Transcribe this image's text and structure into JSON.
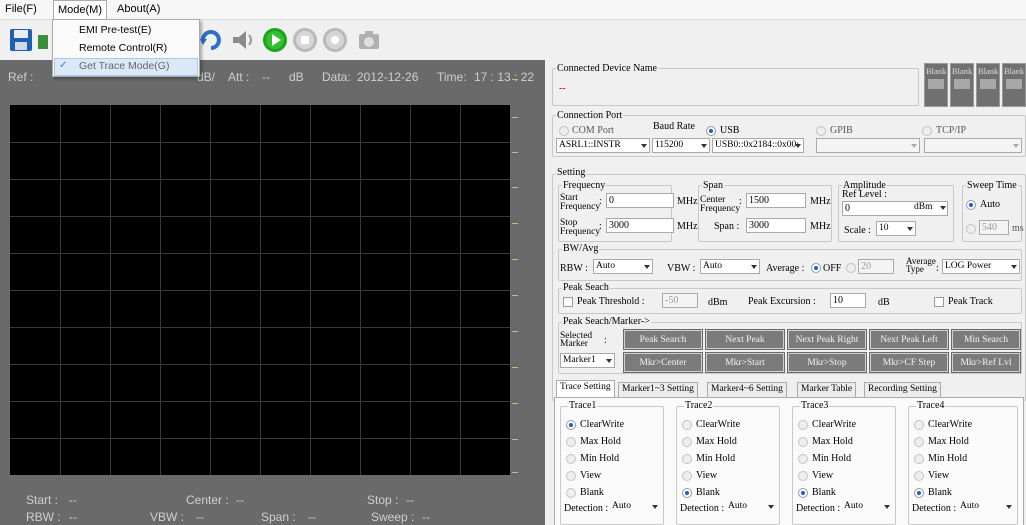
{
  "menubar": {
    "file": "File(F)",
    "mode": "Mode(M)",
    "about": "About(A)"
  },
  "mode_menu": {
    "items": [
      "EMI Pre-test(E)",
      "Remote Control(R)",
      "Get Trace Mode(G)"
    ]
  },
  "toolbar": {
    "icons": [
      "save-icon",
      "open-icon",
      "refresh-icon",
      "speaker-icon",
      "play-icon",
      "stop-icon",
      "record-icon",
      "camera-icon"
    ]
  },
  "top_info": {
    "ref_label": "Ref :",
    "db_div": "dB/",
    "att_label": "Att :",
    "att_value": "--",
    "att_unit": "dB",
    "data_label": "Data:",
    "data_value": "2012-12-26",
    "time_label": "Time:",
    "time_value": "17 : 13 : 22"
  },
  "bottom_info": {
    "start_label": "Start :",
    "start_value": "--",
    "center_label": "Center :",
    "center_value": "--",
    "stop_label": "Stop :",
    "stop_value": "--",
    "rbw_label": "RBW :",
    "rbw_value": "--",
    "vbw_label": "VBW :",
    "vbw_value": "--",
    "span_label": "Span :",
    "span_value": "--",
    "sweep_label": "Sweep :",
    "sweep_value": "--"
  },
  "connected": {
    "title": "Connected Device Name",
    "value": "--",
    "blanks": [
      "Blank",
      "Blank",
      "Blank",
      "Blank"
    ]
  },
  "connection_port": {
    "title": "Connection Port",
    "com_port": "COM Port",
    "baud_rate": "Baud Rate",
    "usb": "USB",
    "gpib": "GPIB",
    "tcpip": "TCP/IP",
    "com_value": "ASRL1::INSTR",
    "baud_value": "115200",
    "usb_value": "USB0::0x2184::0x00:"
  },
  "setting": {
    "title": "Setting",
    "frequency": {
      "title": "Frequecny",
      "start_label": "Start\nFrequency",
      "start_value": "0",
      "stop_label": "Stop\nFrequency",
      "stop_value": "3000",
      "unit": "MHz"
    },
    "span": {
      "title": "Span",
      "center_label": "Center\nFrequency",
      "center_value": "1500",
      "span_label": "Span :",
      "span_value": "3000",
      "unit": "MHz"
    },
    "amplitude": {
      "title": "Amplitude",
      "ref_label": "Ref Level :",
      "ref_value": "0",
      "ref_unit": "dBm",
      "scale_label": "Scale :",
      "scale_value": "10"
    },
    "sweep": {
      "title": "Sweep Time",
      "auto": "Auto",
      "ms_value": "540",
      "ms": "ms"
    },
    "bw": {
      "title": "BW/Avg",
      "rbw_label": "RBW :",
      "rbw_value": "Auto",
      "vbw_label": "VBW :",
      "vbw_value": "Auto",
      "avg_label": "Average :",
      "off": "OFF",
      "avg_num": "20",
      "avg_type_label": "Average\nType",
      "avg_type_value": "LOG Power"
    },
    "peak": {
      "title": "Peak Seach",
      "threshold_label": "Peak Threshold :",
      "threshold_value": "-50",
      "threshold_unit": "dBm",
      "excursion_label": "Peak Excursion :",
      "excursion_value": "10",
      "excursion_unit": "dB",
      "track": "Peak Track"
    },
    "marker": {
      "title": "Peak Seach/Marker->",
      "selected_label": "Selected\nMarker",
      "selected_value": "Marker1",
      "buttons_row1": [
        "Peak Search",
        "Next Peak",
        "Next Peak Right",
        "Next Peak Left",
        "Min Search"
      ],
      "buttons_row2": [
        "Mkr>Center",
        "Mkr>Start",
        "Mkr>Stop",
        "Mkr>CF Step",
        "Mkr>Ref Lvl"
      ]
    }
  },
  "tabs": [
    "Trace Setting",
    "Marker1~3 Setting",
    "Marker4~6 Setting",
    "Marker Table",
    "Recording Setting"
  ],
  "traces": [
    {
      "title": "Trace1",
      "options": [
        "ClearWrite",
        "Max Hold",
        "Min Hold",
        "View",
        "Blank"
      ],
      "selected": 0,
      "detection_label": "Detection :",
      "detection_value": "Auto"
    },
    {
      "title": "Trace2",
      "options": [
        "ClearWrite",
        "Max Hold",
        "Min Hold",
        "View",
        "Blank"
      ],
      "selected": 4,
      "detection_label": "Detection :",
      "detection_value": "Auto"
    },
    {
      "title": "Trace3",
      "options": [
        "ClearWrite",
        "Max Hold",
        "Min Hold",
        "View",
        "Blank"
      ],
      "selected": 4,
      "detection_label": "Detection :",
      "detection_value": "Auto"
    },
    {
      "title": "Trace4",
      "options": [
        "ClearWrite",
        "Max Hold",
        "Min Hold",
        "View",
        "Blank"
      ],
      "selected": 4,
      "detection_label": "Detection :",
      "detection_value": "Auto"
    }
  ]
}
